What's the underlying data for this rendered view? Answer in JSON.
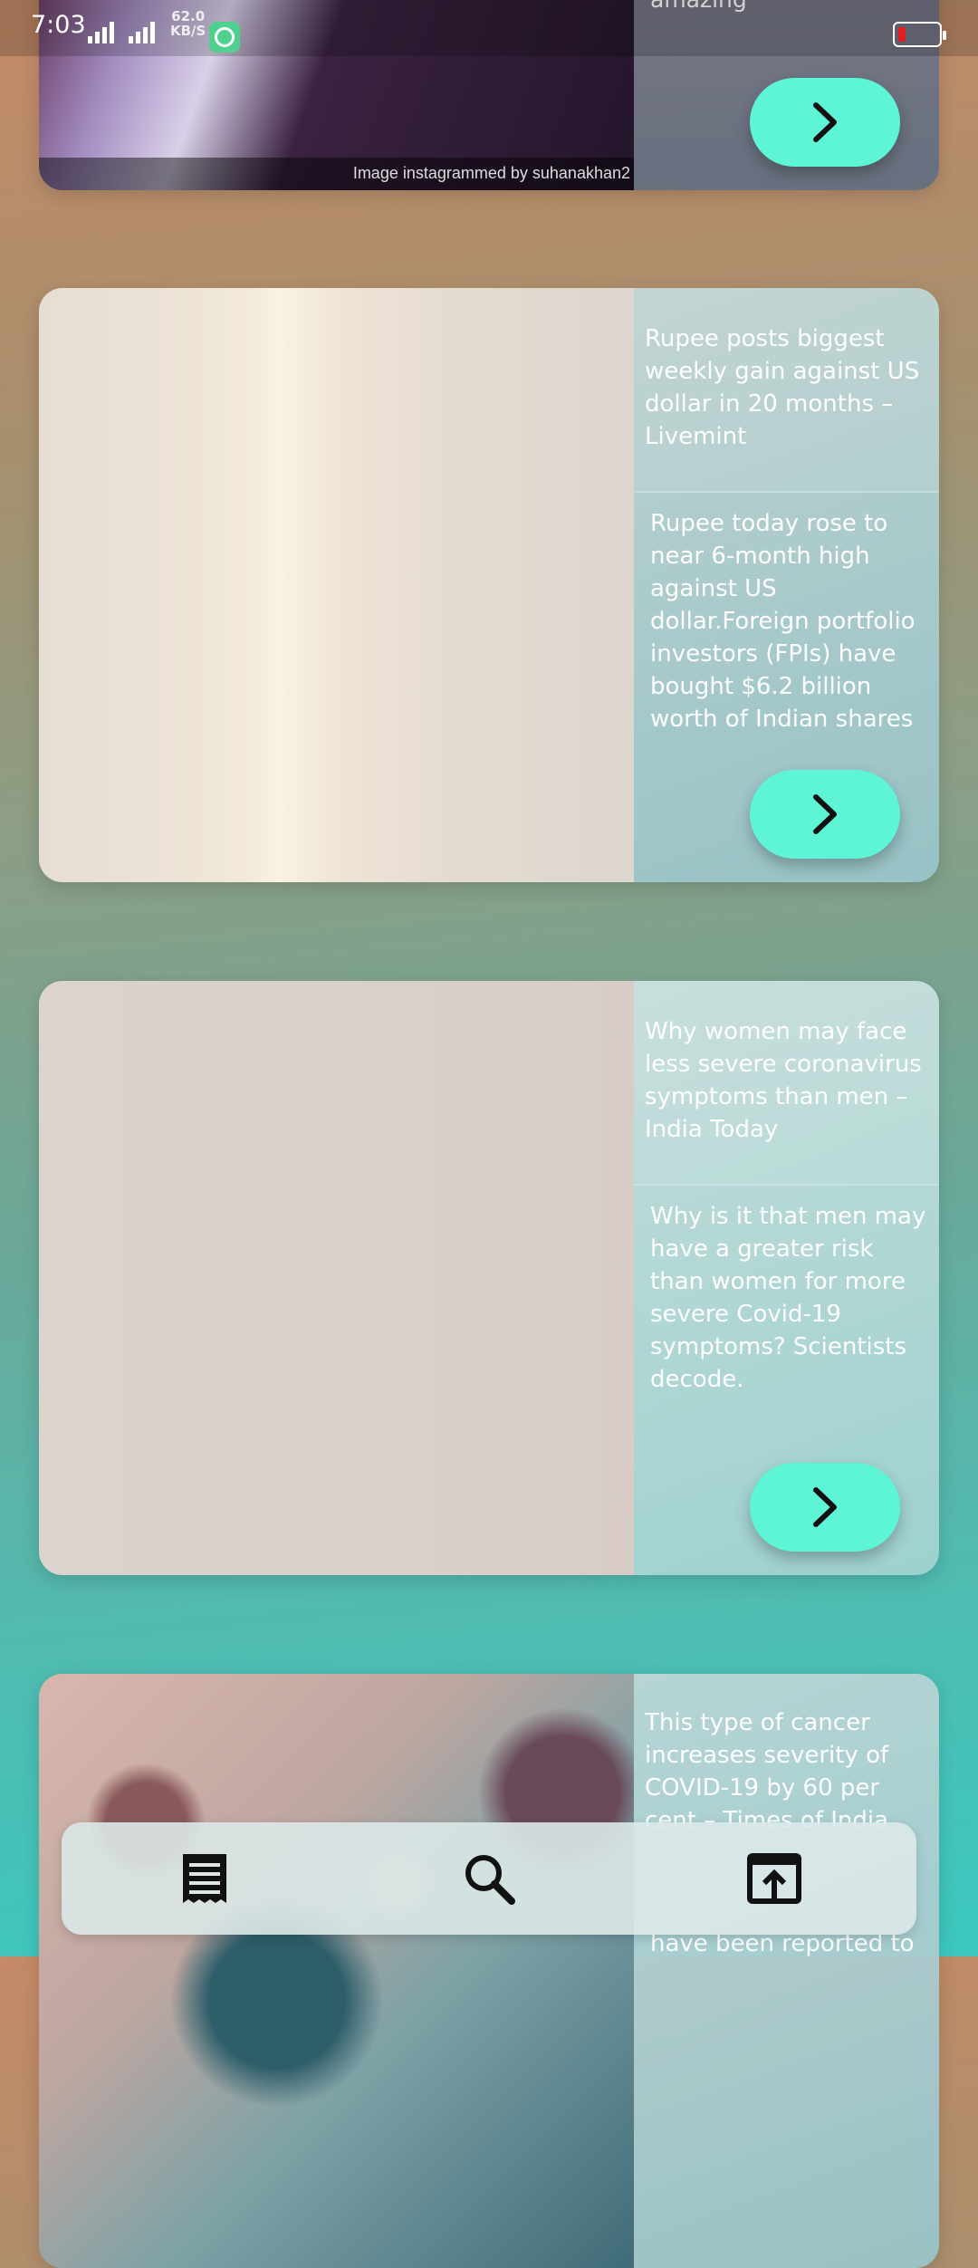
{
  "status_bar": {
    "time": "7:03",
    "network_speed": "62.0",
    "network_speed_unit": "KB/S"
  },
  "cards": [
    {
      "image_caption": "Image instagrammed by suhanakhan2",
      "description_tail": "section, \"This was amazing\""
    },
    {
      "title": "Rupee posts biggest weekly gain against US dollar in 20 months – Livemint",
      "description": "Rupee today rose to near 6-month high against US dollar.Foreign portfolio investors (FPIs) have bought $6.2 billion worth of Indian shares so far in this month"
    },
    {
      "title": "Why women may face less severe coronavirus symptoms than men – India Today",
      "description": "Why is it that men may have a greater risk than women for more severe Covid-19 symptoms? Scientists decode."
    },
    {
      "title": "This type of cancer increases severity of COVID-19 by 60 per cent – Times of India",
      "description_tail": "have been reported to"
    }
  ],
  "bottom_nav": {
    "items": [
      {
        "icon": "news-feed-icon"
      },
      {
        "icon": "search-icon"
      },
      {
        "icon": "open-external-icon"
      }
    ]
  },
  "colors": {
    "accent_button": "#5ef5d6",
    "battery_low": "#e02020"
  }
}
